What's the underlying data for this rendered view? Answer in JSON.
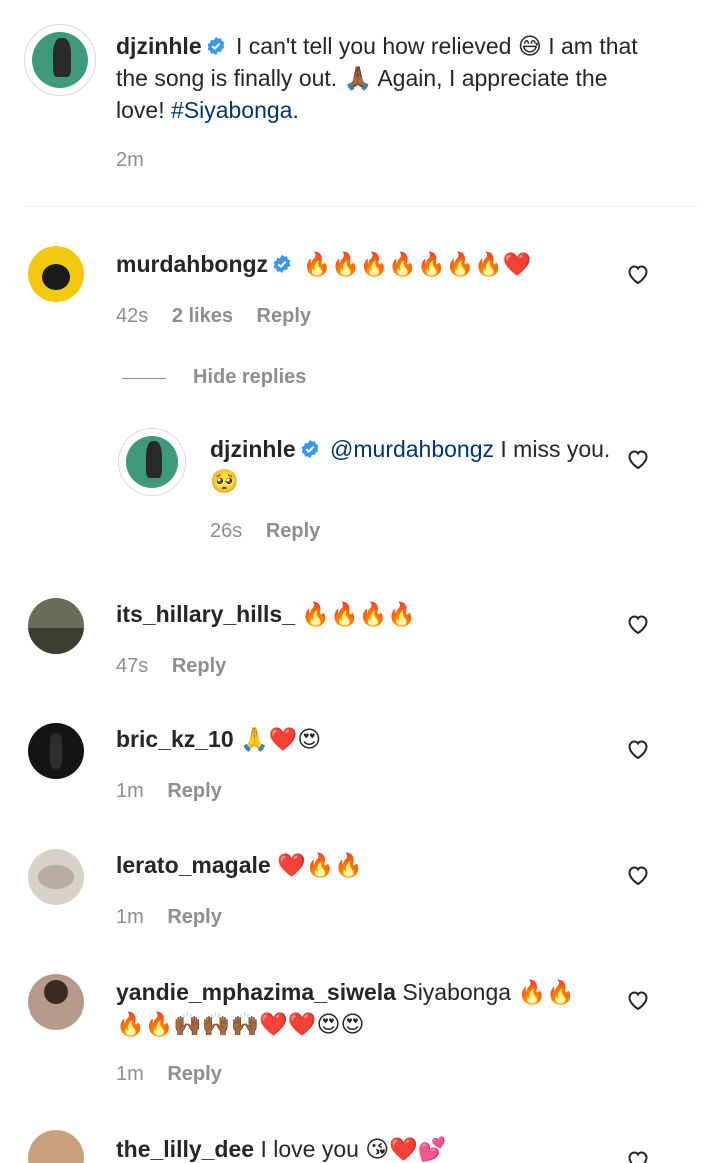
{
  "caption": {
    "username": "djzinhle",
    "text_a": "I can't tell you how relieved 😅 I am that the song is finally out. 🙏🏾 Again, I appreciate the love! ",
    "hashtag": "#Siyabonga",
    "text_b": ".",
    "time": "2m"
  },
  "comments": [
    {
      "username": "murdahbongz",
      "verified": true,
      "text": "🔥🔥🔥🔥🔥🔥🔥❤️",
      "time": "42s",
      "likes": "2 likes",
      "reply_label": "Reply",
      "avatar_color": "#f2c811"
    },
    {
      "username": "its_hillary_hills_",
      "text": "🔥🔥🔥🔥",
      "time": "47s",
      "reply_label": "Reply",
      "avatar_color": "#6b6b5a"
    },
    {
      "username": "bric_kz_10",
      "text": "🙏❤️😍",
      "time": "1m",
      "reply_label": "Reply",
      "avatar_color": "#141414"
    },
    {
      "username": "lerato_magale",
      "text": "❤️🔥🔥",
      "time": "1m",
      "reply_label": "Reply",
      "avatar_color": "#d9d2c8"
    },
    {
      "username": "yandie_mphazima_siwela",
      "text": "Siyabonga 🔥🔥🔥🔥🙌🏾🙌🏾🙌🏾❤️❤️😍😍",
      "time": "1m",
      "reply_label": "Reply",
      "avatar_color": "#b89a8c"
    },
    {
      "username": "the_lilly_dee",
      "text": "I love you 😘❤️💕",
      "avatar_color": "#c8a07a"
    }
  ],
  "hide_replies": "Hide replies",
  "reply": {
    "username": "djzinhle",
    "mention": "@murdahbongz",
    "text": " I miss you. 🥺",
    "time": "26s",
    "reply_label": "Reply"
  },
  "colors": {
    "link": "#00376b",
    "verified": "#3897f0",
    "meta": "#8e8e8e"
  },
  "icons": [
    "verified-badge-icon",
    "heart-outline-icon"
  ]
}
